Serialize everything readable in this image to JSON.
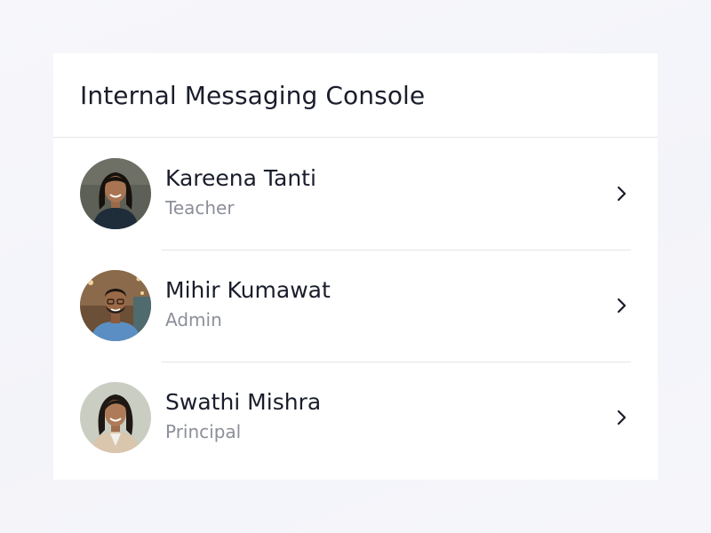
{
  "header": {
    "title": "Internal Messaging Console"
  },
  "contacts": [
    {
      "name": "Kareena Tanti",
      "role": "Teacher",
      "avatar": "woman-portrait"
    },
    {
      "name": "Mihir Kumawat",
      "role": "Admin",
      "avatar": "man-portrait"
    },
    {
      "name": "Swathi Mishra",
      "role": "Principal",
      "avatar": "woman-portrait"
    }
  ],
  "icons": {
    "row_action": "chevron-right-icon"
  },
  "colors": {
    "title_text": "#1a1d2b",
    "secondary_text": "#8c8f99",
    "divider": "#e4e5ea",
    "card_background": "#ffffff"
  }
}
